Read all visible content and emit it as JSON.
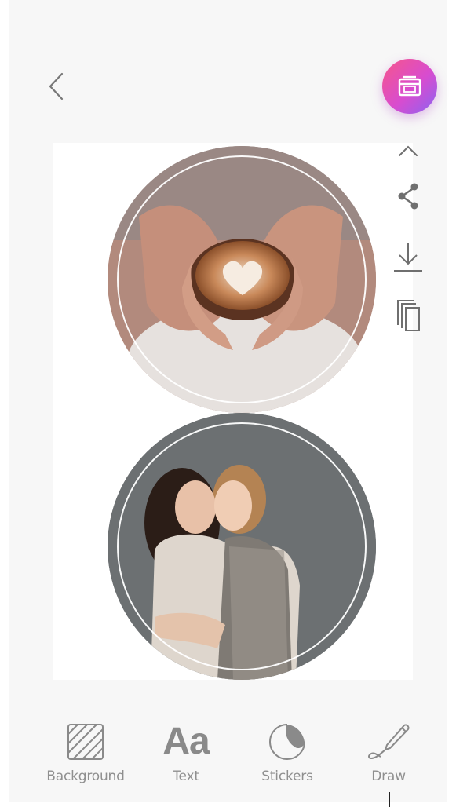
{
  "header": {
    "back_icon": "chevron-left-icon",
    "print_icon": "printer-icon",
    "print_gradient": [
      "#f7568a",
      "#d84ccf",
      "#8a63f2"
    ]
  },
  "canvas": {
    "photos": [
      {
        "subject": "coffee-cup-hands",
        "icon": "photo"
      },
      {
        "subject": "two-women-hugging",
        "icon": "photo"
      }
    ]
  },
  "side_tools": {
    "collapse_icon": "chevron-up-icon",
    "share_icon": "share-icon",
    "download_icon": "download-icon",
    "copy_icon": "copy-icon"
  },
  "bottom_bar": {
    "tools": [
      {
        "label": "Background",
        "icon": "background-pattern-icon"
      },
      {
        "label": "Text",
        "glyph": "Aa",
        "icon": "text-icon"
      },
      {
        "label": "Stickers",
        "icon": "sticker-icon"
      },
      {
        "label": "Draw",
        "icon": "pen-icon"
      }
    ]
  }
}
